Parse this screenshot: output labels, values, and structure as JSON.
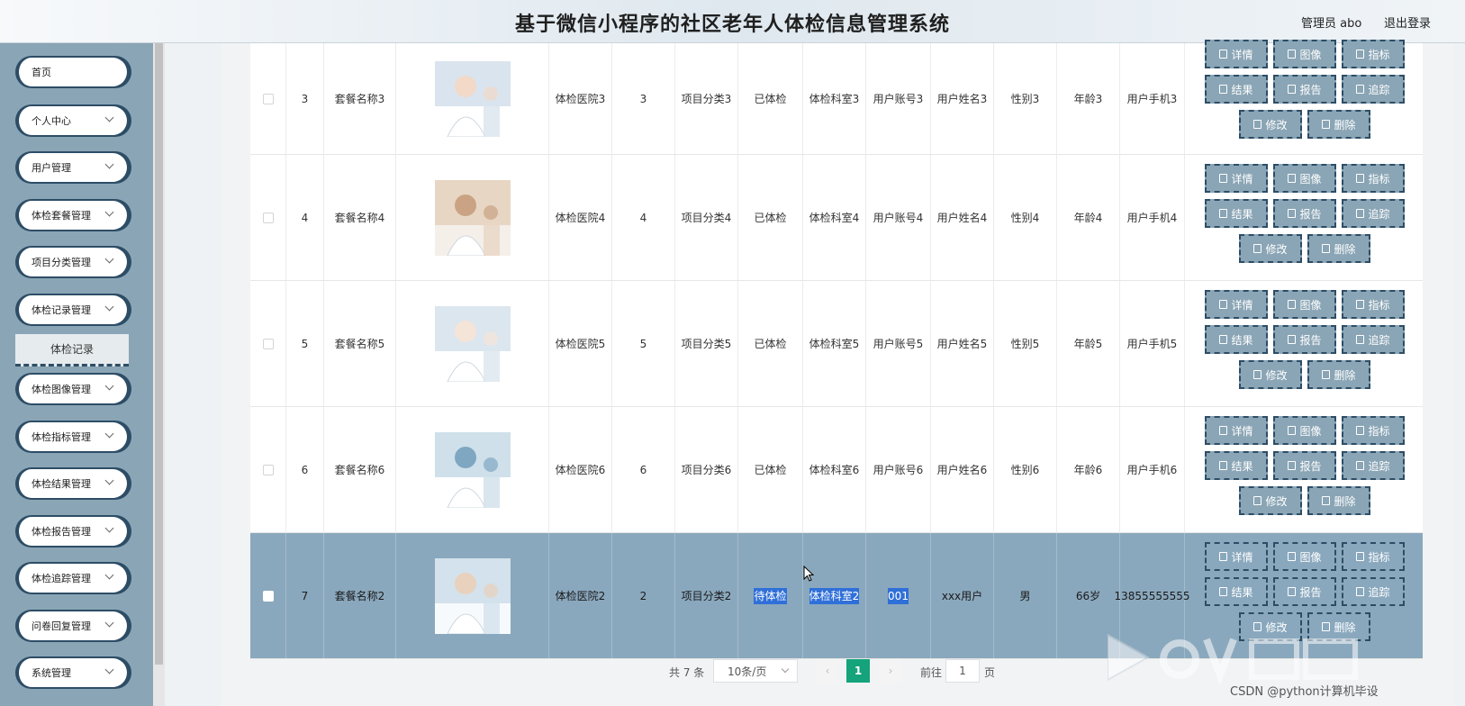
{
  "header": {
    "title": "基于微信小程序的社区老年人体检信息管理系统",
    "admin": "管理员 abo",
    "logout": "退出登录"
  },
  "sidebar": {
    "items": [
      {
        "label": "首页",
        "chevron": false
      },
      {
        "label": "个人中心",
        "chevron": true
      },
      {
        "label": "用户管理",
        "chevron": true
      },
      {
        "label": "体检套餐管理",
        "chevron": true
      },
      {
        "label": "项目分类管理",
        "chevron": true
      },
      {
        "label": "体检记录管理",
        "chevron": true
      },
      {
        "label": "体检图像管理",
        "chevron": true
      },
      {
        "label": "体检指标管理",
        "chevron": true
      },
      {
        "label": "体检结果管理",
        "chevron": true
      },
      {
        "label": "体检报告管理",
        "chevron": true
      },
      {
        "label": "体检追踪管理",
        "chevron": true
      },
      {
        "label": "问卷回复管理",
        "chevron": true
      },
      {
        "label": "系统管理",
        "chevron": true
      }
    ],
    "sub_item": "体检记录"
  },
  "table": {
    "rows": [
      {
        "idx": "3",
        "pkg": "套餐名称3",
        "hospital": "体检医院3",
        "num": "3",
        "category": "项目分类3",
        "status": "已体检",
        "dept": "体检科室3",
        "account": "用户账号3",
        "name": "用户姓名3",
        "gender": "性别3",
        "age": "年龄3",
        "phone": "用户手机3",
        "selected": false
      },
      {
        "idx": "4",
        "pkg": "套餐名称4",
        "hospital": "体检医院4",
        "num": "4",
        "category": "项目分类4",
        "status": "已体检",
        "dept": "体检科室4",
        "account": "用户账号4",
        "name": "用户姓名4",
        "gender": "性别4",
        "age": "年龄4",
        "phone": "用户手机4",
        "selected": false
      },
      {
        "idx": "5",
        "pkg": "套餐名称5",
        "hospital": "体检医院5",
        "num": "5",
        "category": "项目分类5",
        "status": "已体检",
        "dept": "体检科室5",
        "account": "用户账号5",
        "name": "用户姓名5",
        "gender": "性别5",
        "age": "年龄5",
        "phone": "用户手机5",
        "selected": false
      },
      {
        "idx": "6",
        "pkg": "套餐名称6",
        "hospital": "体检医院6",
        "num": "6",
        "category": "项目分类6",
        "status": "已体检",
        "dept": "体检科室6",
        "account": "用户账号6",
        "name": "用户姓名6",
        "gender": "性别6",
        "age": "年龄6",
        "phone": "用户手机6",
        "selected": false
      },
      {
        "idx": "7",
        "pkg": "套餐名称2",
        "hospital": "体检医院2",
        "num": "2",
        "category": "项目分类2",
        "status": "待体检",
        "dept": "体检科室2",
        "account": "001",
        "name": "xxx用户",
        "gender": "男",
        "age": "66岁",
        "phone": "13855555555",
        "selected": true
      }
    ],
    "actions": [
      "详情",
      "图像",
      "指标",
      "结果",
      "报告",
      "追踪",
      "修改",
      "删除"
    ]
  },
  "pager": {
    "total": "共 7 条",
    "page_size": "10条/页",
    "current_page": "1",
    "goto_label": "前往",
    "goto_value": "1",
    "goto_unit": "页",
    "prev": "‹",
    "next": "›"
  },
  "watermark": "CSDN @python计算机毕设",
  "colors": {
    "sidebar": "#8aa5b5",
    "accent": "#2d4d66",
    "page_active": "#14a37a",
    "selected_row": "#8aa8bd"
  }
}
